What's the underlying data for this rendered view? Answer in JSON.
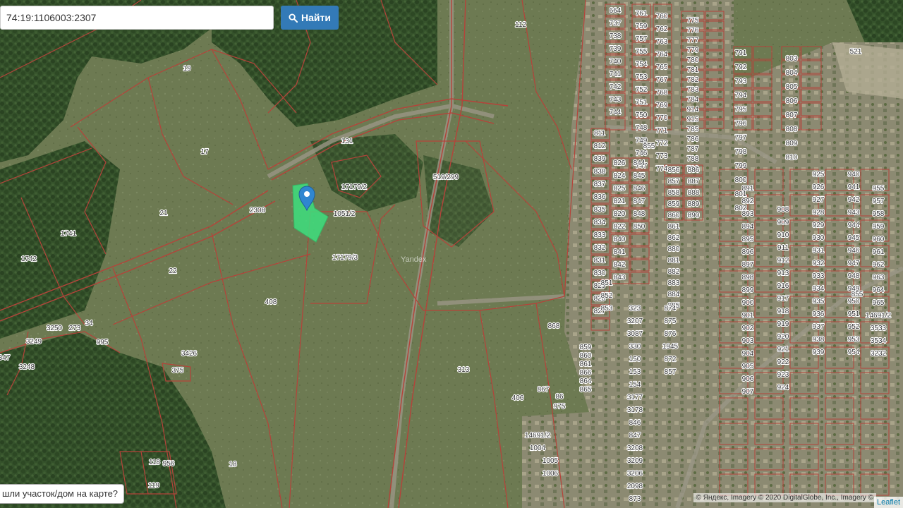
{
  "search": {
    "value": "74:19:1106003:2307",
    "button_label": "Найти",
    "button_icon": "search-icon"
  },
  "help": {
    "text": "шли участок/дом на карте?"
  },
  "attribution": {
    "text": "© Яндекс, Imagery © 2020 DigitalGlobe, Inc., Imagery ©",
    "leaflet": "Leaflet"
  },
  "watermark": "Yandex",
  "selected_parcel": {
    "color": "#3ee07e",
    "marker": "map-pin-icon",
    "marker_color": "#2f86d0"
  },
  "colors": {
    "boundary": "#b5433a",
    "label_bg": "#ffffff"
  },
  "parcel_labels": [
    "112",
    "521",
    "19",
    "17",
    "131",
    "17179/2",
    "519/299",
    "1051/2",
    "2308",
    "21",
    "1741",
    "1742",
    "22",
    "17179/3",
    "408",
    "3426",
    "375",
    "313",
    "406",
    "18",
    "119",
    "118",
    "956",
    "995",
    "3249",
    "3250",
    "273",
    "34",
    "3248",
    "347",
    "664",
    "737",
    "738",
    "739",
    "740",
    "741",
    "742",
    "743",
    "744",
    "761",
    "759",
    "757",
    "755",
    "754",
    "753",
    "752",
    "751",
    "750",
    "748",
    "749",
    "746",
    "747",
    "760",
    "762",
    "763",
    "764",
    "765",
    "767",
    "768",
    "769",
    "770",
    "771",
    "772",
    "773",
    "774",
    "775",
    "776",
    "777",
    "779",
    "780",
    "781",
    "782",
    "783",
    "784",
    "914",
    "915",
    "785",
    "786",
    "787",
    "788",
    "790",
    "791",
    "792",
    "793",
    "794",
    "795",
    "796",
    "797",
    "798",
    "799",
    "800",
    "801",
    "802",
    "803",
    "804",
    "805",
    "806",
    "807",
    "808",
    "809",
    "810",
    "811",
    "812",
    "839",
    "838",
    "837",
    "836",
    "835",
    "834",
    "833",
    "832",
    "831",
    "830",
    "829",
    "828",
    "827",
    "826",
    "824",
    "825",
    "821",
    "820",
    "822",
    "840",
    "841",
    "842",
    "843",
    "844",
    "845",
    "846",
    "847",
    "848",
    "850",
    "851",
    "852",
    "853",
    "854",
    "855",
    "856",
    "857",
    "858",
    "859",
    "860",
    "861",
    "862",
    "880",
    "881",
    "882",
    "883",
    "884",
    "885",
    "886",
    "887",
    "888",
    "889",
    "890",
    "891",
    "892",
    "893",
    "894",
    "895",
    "896",
    "897",
    "898",
    "899",
    "900",
    "901",
    "902",
    "903",
    "904",
    "905",
    "906",
    "907",
    "908",
    "909",
    "910",
    "911",
    "912",
    "913",
    "916",
    "917",
    "918",
    "919",
    "920",
    "921",
    "922",
    "923",
    "924",
    "925",
    "926",
    "927",
    "928",
    "929",
    "930",
    "931",
    "932",
    "933",
    "934",
    "935",
    "936",
    "937",
    "938",
    "939",
    "940",
    "941",
    "942",
    "943",
    "944",
    "945",
    "946",
    "947",
    "948",
    "949",
    "950",
    "951",
    "952",
    "953",
    "954",
    "955",
    "957",
    "958",
    "959",
    "960",
    "961",
    "962",
    "963",
    "964",
    "965",
    "14691/2",
    "3533",
    "3534",
    "3232",
    "323",
    "3207",
    "3087",
    "330",
    "150",
    "153",
    "154",
    "3177",
    "3178",
    "846",
    "847",
    "3208",
    "3209",
    "3206",
    "2098",
    "873",
    "874",
    "875",
    "876",
    "1945",
    "872",
    "857",
    "855",
    "859",
    "860",
    "861",
    "866",
    "864",
    "865",
    "868",
    "867",
    "86",
    "975",
    "14691/2b",
    "1004",
    "1005",
    "1006"
  ]
}
